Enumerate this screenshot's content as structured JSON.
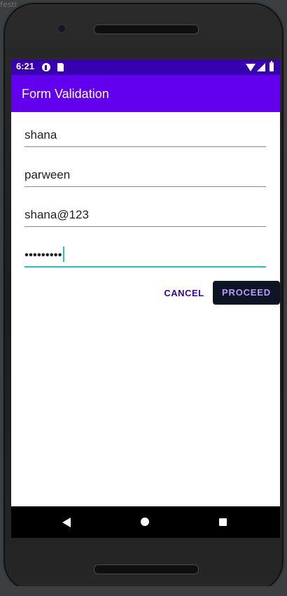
{
  "ide": {
    "top_label": "festi"
  },
  "status_bar": {
    "time": "6:21",
    "icons": [
      "p-icon",
      "sd-card-icon",
      "wifi-icon",
      "signal-icon",
      "battery-icon"
    ]
  },
  "app_bar": {
    "title": "Form Validation"
  },
  "form": {
    "first_name": "shana",
    "last_name": "parween",
    "email": "shana@123",
    "password_masked": "•••••••••"
  },
  "buttons": {
    "cancel": "CANCEL",
    "proceed": "PROCEED"
  },
  "colors": {
    "status_bar": "#3700b3",
    "app_bar": "#6200ee",
    "focus_accent": "#1ec6c6",
    "cancel_text": "#3700b3",
    "proceed_bg": "#0d1423",
    "proceed_text": "#b79cff"
  },
  "nav_bar": {
    "icons": [
      "back-icon",
      "home-icon",
      "recents-icon"
    ]
  }
}
